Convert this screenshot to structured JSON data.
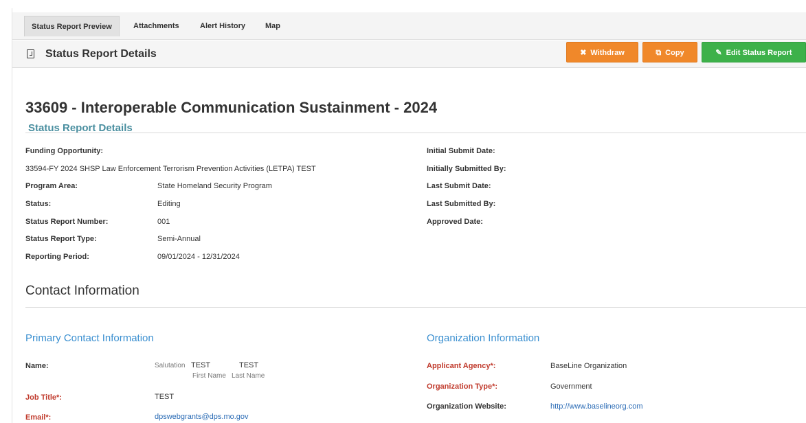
{
  "tabs": [
    {
      "label": "Status Report Preview",
      "active": true
    },
    {
      "label": "Attachments",
      "active": false
    },
    {
      "label": "Alert History",
      "active": false
    },
    {
      "label": "Map",
      "active": false
    }
  ],
  "header": {
    "title": "Status Report Details",
    "withdraw_label": "Withdraw",
    "copy_label": "Copy",
    "edit_label": "Edit Status Report"
  },
  "report": {
    "title": "33609 - Interoperable Communication Sustainment - 2024",
    "subtitle": "Status Report Details"
  },
  "details_left": {
    "funding_opportunity_label": "Funding Opportunity:",
    "funding_opportunity_value": "33594-FY 2024 SHSP Law Enforcement Terrorism Prevention Activities (LETPA) TEST",
    "program_area_label": "Program Area:",
    "program_area_value": "State Homeland Security Program",
    "status_label": "Status:",
    "status_value": "Editing",
    "number_label": "Status Report Number:",
    "number_value": "001",
    "type_label": "Status Report Type:",
    "type_value": "Semi-Annual",
    "period_label": "Reporting Period:",
    "period_value": "09/01/2024 - 12/31/2024"
  },
  "details_right": {
    "initial_submit_date_label": "Initial Submit Date:",
    "initially_submitted_by_label": "Initially Submitted By:",
    "last_submit_date_label": "Last Submit Date:",
    "last_submitted_by_label": "Last Submitted By:",
    "approved_date_label": "Approved Date:"
  },
  "contact": {
    "section_title": "Contact Information",
    "primary_title": "Primary Contact Information",
    "name_label": "Name:",
    "salutation_text": "Salutation",
    "first_name_value": "TEST",
    "last_name_value": "TEST",
    "first_name_caption": "First Name",
    "last_name_caption": "Last Name",
    "job_title_label": "Job Title*:",
    "job_title_value": "TEST",
    "email_label": "Email*:",
    "email_value": "dpswebgrants@dps.mo.gov"
  },
  "organization": {
    "title": "Organization Information",
    "agency_label": "Applicant Agency*:",
    "agency_value": "BaseLine Organization",
    "type_label": "Organization Type*:",
    "type_value": "Government",
    "website_label": "Organization Website:",
    "website_value": "http://www.baselineorg.com"
  }
}
